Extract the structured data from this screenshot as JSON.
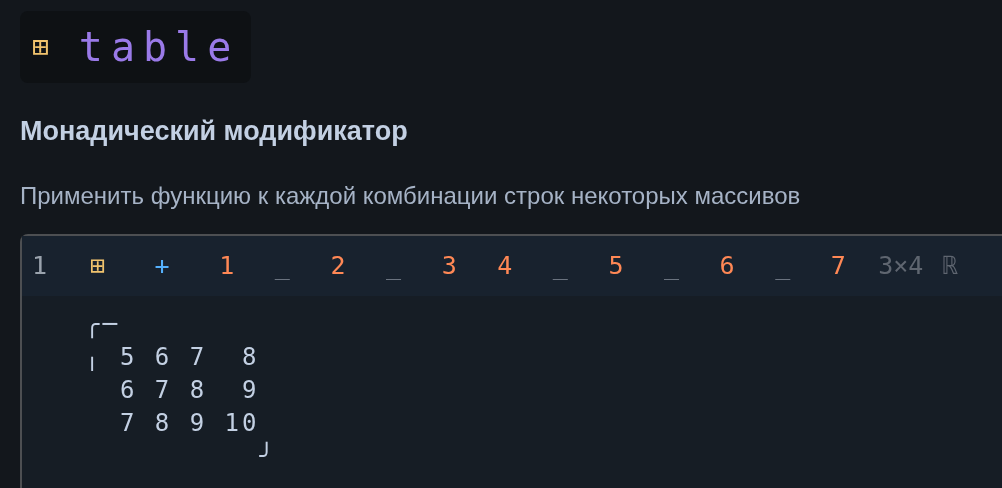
{
  "badge": {
    "glyph": "⊞",
    "name": "table"
  },
  "heading": "Монадический модификатор",
  "description": "Применить функцию к каждой комбинации строк некоторых массивов",
  "code": {
    "line_number": "1",
    "tokens": [
      {
        "text": "⊞",
        "kind": "modifier"
      },
      {
        "text": "+",
        "kind": "function"
      },
      {
        "text": "1",
        "kind": "number"
      },
      {
        "text": "_",
        "kind": "strand"
      },
      {
        "text": "2",
        "kind": "number"
      },
      {
        "text": "_",
        "kind": "strand"
      },
      {
        "text": "3",
        "kind": "number"
      },
      {
        "text": "4",
        "kind": "number"
      },
      {
        "text": "_",
        "kind": "strand"
      },
      {
        "text": "5",
        "kind": "number"
      },
      {
        "text": "_",
        "kind": "strand"
      },
      {
        "text": "6",
        "kind": "number"
      },
      {
        "text": "_",
        "kind": "strand"
      },
      {
        "text": "7",
        "kind": "number"
      }
    ],
    "shape": "3×4",
    "type": "ℝ"
  },
  "output": [
    "╭─",
    "╷ 5 6 7  8",
    "  6 7 8  9",
    "  7 8 9 10",
    "          ╯"
  ]
}
